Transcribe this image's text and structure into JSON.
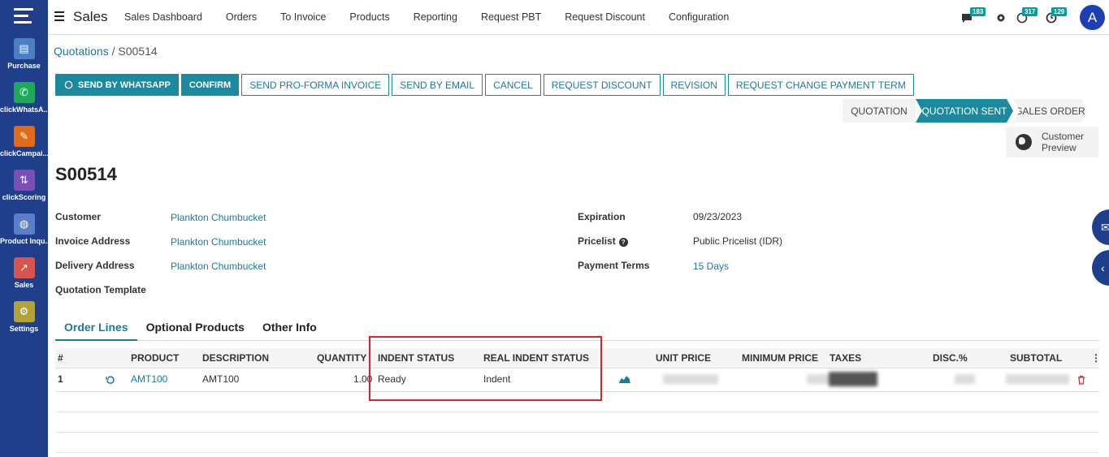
{
  "rail": {
    "items": [
      {
        "label": "Purchase",
        "icon": "purchase-icon",
        "color": "#4a7fc1"
      },
      {
        "label": "clickWhatsA...",
        "icon": "whatsapp-icon",
        "color": "#1fa85a"
      },
      {
        "label": "clickCampai...",
        "icon": "campaign-icon",
        "color": "#e06b1a"
      },
      {
        "label": "clickScoring",
        "icon": "scoring-icon",
        "color": "#7b4fb8"
      },
      {
        "label": "Product Inqu...",
        "icon": "product-inquiry-icon",
        "color": "#5a7fc8"
      },
      {
        "label": "Sales",
        "icon": "sales-icon",
        "color": "#d9534f"
      },
      {
        "label": "Settings",
        "icon": "gear-icon",
        "color": "#b3a13a"
      }
    ]
  },
  "topbar": {
    "brand": "Sales",
    "nav": [
      "Sales Dashboard",
      "Orders",
      "To Invoice",
      "Products",
      "Reporting",
      "Request PBT",
      "Request Discount",
      "Configuration"
    ],
    "badges": {
      "chat": "183",
      "whatsapp": "317",
      "activity": "129"
    },
    "avatar": "A"
  },
  "breadcrumb": {
    "parent": "Quotations",
    "separator": "/",
    "current": "S00514"
  },
  "actions": {
    "whatsapp": "SEND BY WHATSAPP",
    "confirm": "CONFIRM",
    "proforma": "SEND PRO-FORMA INVOICE",
    "email": "SEND BY EMAIL",
    "cancel": "CANCEL",
    "discount": "REQUEST DISCOUNT",
    "revision": "REVISION",
    "payment_term": "REQUEST CHANGE PAYMENT TERM"
  },
  "status": {
    "stage1": "QUOTATION",
    "stage2": "QUOTATION SENT",
    "stage3": "SALES ORDER",
    "active": "QUOTATION SENT"
  },
  "preview": {
    "line1": "Customer",
    "line2": "Preview"
  },
  "record": {
    "title": "S00514",
    "customer_label": "Customer",
    "customer": "Plankton Chumbucket",
    "invoice_label": "Invoice Address",
    "invoice": "Plankton Chumbucket",
    "delivery_label": "Delivery Address",
    "delivery": "Plankton Chumbucket",
    "template_label": "Quotation Template",
    "expiration_label": "Expiration",
    "expiration": "09/23/2023",
    "pricelist_label": "Pricelist",
    "pricelist": "Public Pricelist (IDR)",
    "payment_label": "Payment Terms",
    "payment": "15 Days"
  },
  "tabs": [
    "Order Lines",
    "Optional Products",
    "Other Info"
  ],
  "table": {
    "headers": {
      "num": "#",
      "product": "PRODUCT",
      "description": "DESCRIPTION",
      "quantity": "QUANTITY",
      "indent": "INDENT STATUS",
      "real_indent": "REAL INDENT STATUS",
      "unit_price": "UNIT PRICE",
      "min_price": "MINIMUM PRICE",
      "taxes": "TAXES",
      "disc": "DISC.%",
      "subtotal": "SUBTOTAL"
    },
    "rows": [
      {
        "num": "1",
        "product": "AMT100",
        "description": "AMT100",
        "quantity": "1.00",
        "indent": "Ready",
        "real_indent": "Indent"
      }
    ]
  },
  "colors": {
    "rail": "#1f3f8a",
    "accent": "#1a8a9c",
    "link": "#1c7a9c",
    "highlight": "#d9232d"
  }
}
